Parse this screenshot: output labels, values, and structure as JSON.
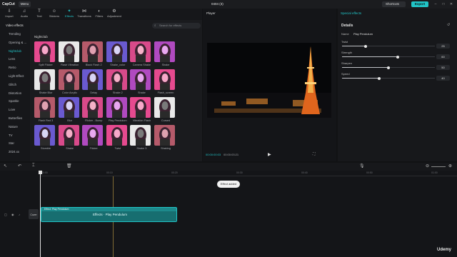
{
  "titlebar": {
    "logo": "CapCut",
    "menu_label": "Menu",
    "project_title": "0404 (3)",
    "shortcuts_label": "Shortcuts",
    "export_label": "Export"
  },
  "tools": [
    {
      "label": "Import",
      "icon": "import-icon"
    },
    {
      "label": "Audio",
      "icon": "audio-icon"
    },
    {
      "label": "Text",
      "icon": "text-icon"
    },
    {
      "label": "Stickers",
      "icon": "stickers-icon"
    },
    {
      "label": "Effects",
      "icon": "effects-icon",
      "active": true
    },
    {
      "label": "Transitions",
      "icon": "transitions-icon"
    },
    {
      "label": "Filters",
      "icon": "filters-icon"
    },
    {
      "label": "Adjustment",
      "icon": "adjustment-icon"
    }
  ],
  "categories": {
    "header": "Video effects",
    "items": [
      "Trending",
      "Opening & ...",
      "Nightclub",
      "Lens",
      "Retro",
      "Light Effect",
      "Glitch",
      "Distortion",
      "Sparkle",
      "Love",
      "Butterflies",
      "Nature",
      "TV",
      "Star",
      "2024.xx"
    ],
    "selected": "Nightclub"
  },
  "search": {
    "placeholder": "Search for effects"
  },
  "effects_section_title": "Nightclub",
  "effects": [
    "Split Flicker",
    "Flash Vibration",
    "Black Flash 2",
    "Shake_color",
    "Camera Shake",
    "Shake",
    "Shake Blur",
    "Color Acrylic",
    "Delay",
    "Shake 2",
    "Shake",
    "Flash_screen",
    "Flash Red 3",
    "Blur",
    "Flicker - Bump",
    "Play Pendulum",
    "Vibration Flash",
    "Cursed",
    "Stumble",
    "Shake",
    "Flicker",
    "Twist",
    "Shake 3",
    "Shaking",
    "Flicker",
    "Wave",
    "Glow",
    "Blur",
    "Shake",
    "Flash"
  ],
  "player": {
    "title": "Player",
    "current_time": "00:00:00:03",
    "total_time": "00:00:03:21"
  },
  "inspector": {
    "title": "Special effects",
    "details_label": "Details",
    "name_label": "Name",
    "name_value": "Play Pendulum",
    "params": [
      {
        "label": "Twist",
        "value": "25"
      },
      {
        "label": "Strength",
        "value": "60"
      },
      {
        "label": "Sharpen",
        "value": "50"
      },
      {
        "label": "Speed",
        "value": "40"
      }
    ]
  },
  "timeline": {
    "ticks": [
      "00:00",
      "00:10",
      "00:20",
      "00:30",
      "00:40",
      "00:50",
      "01:00"
    ],
    "tooltip": "Effect added",
    "cover_label": "Cover",
    "clip_label": "Effect: Play Pendulum",
    "effect_label": "Effects · Play Pendulum"
  },
  "watermark": "Udemy"
}
